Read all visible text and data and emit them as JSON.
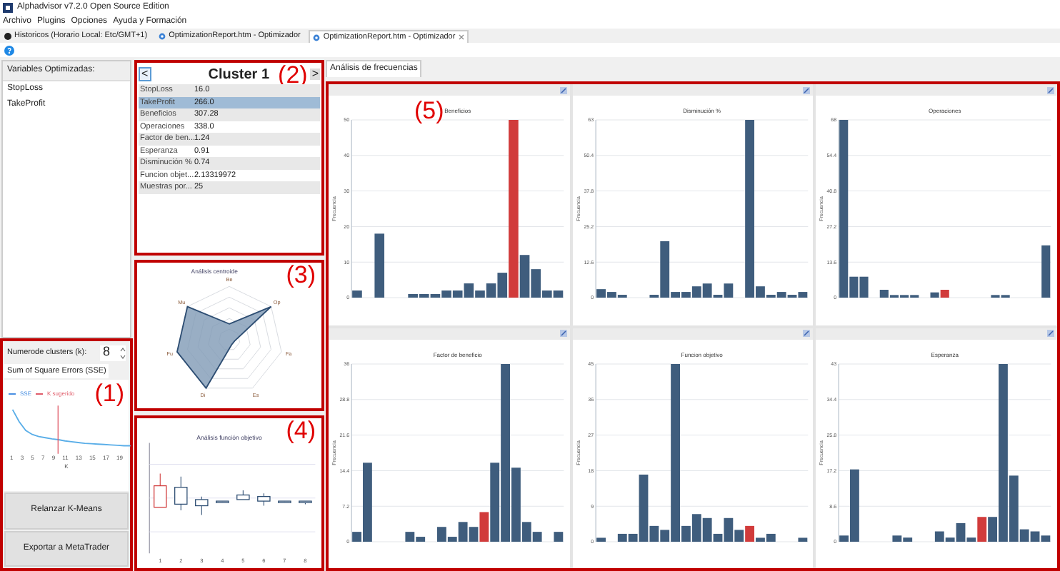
{
  "window": {
    "title": "Alphadvisor v7.2.0 Open Source Edition"
  },
  "menu": [
    "Archivo",
    "Plugins",
    "Opciones",
    "Ayuda y Formación"
  ],
  "tabs": [
    {
      "label": "Historicos (Horario Local: Etc/GMT+1)",
      "kind": "history",
      "selected": false
    },
    {
      "label": "OptimizationReport.htm - Optimizador",
      "kind": "report",
      "selected": false
    },
    {
      "label": "OptimizationReport.htm - Optimizador",
      "kind": "report",
      "selected": true
    }
  ],
  "variables": {
    "header": "Variables Optimizadas:",
    "items": [
      {
        "label": "StopLoss",
        "selected": false
      },
      {
        "label": "TakeProfit",
        "selected": false
      }
    ]
  },
  "kmeans_panel": {
    "annotation": "(1)",
    "spinner": {
      "label": "Numerode clusters (k):",
      "value": "8"
    },
    "tab": "Sum of Square Errors (SSE)",
    "legend": [
      "SSE",
      "K sugerido"
    ],
    "xticks": [
      "1",
      "3",
      "5",
      "7",
      "9",
      "11",
      "13",
      "15",
      "17",
      "19"
    ],
    "xlabel": "K",
    "buttons": [
      "Relanzar K-Means",
      "Exportar a MetaTrader"
    ]
  },
  "cluster_panel": {
    "annotation": "(2)",
    "prev": "<",
    "next": ">",
    "title": "Cluster 1",
    "rows": [
      {
        "name": "StopLoss",
        "value": "16.0",
        "selected": false
      },
      {
        "name": "TakeProfit",
        "value": "266.0",
        "selected": true
      },
      {
        "name": "Beneficios",
        "value": "307.28",
        "selected": false
      },
      {
        "name": "Operaciones",
        "value": "338.0",
        "selected": false
      },
      {
        "name": "Factor de ben...",
        "value": "1.24",
        "selected": false
      },
      {
        "name": "Esperanza",
        "value": "0.91",
        "selected": false
      },
      {
        "name": "Disminución %",
        "value": "0.74",
        "selected": false
      },
      {
        "name": "Funcion objet...",
        "value": "2.13319972",
        "selected": false
      },
      {
        "name": "Muestras por...",
        "value": "25",
        "selected": false
      }
    ]
  },
  "radar_panel": {
    "annotation": "(3)",
    "title": "Análisis centroide",
    "axes": [
      "Be",
      "Op",
      "Fa",
      "Es",
      "Di",
      "Fu",
      "Mu"
    ]
  },
  "boxplot_panel": {
    "annotation": "(4)",
    "title": "Análisis función objetivo",
    "xticks": [
      "1",
      "2",
      "3",
      "4",
      "5",
      "6",
      "7",
      "8"
    ]
  },
  "frequency_panel": {
    "annotation": "(5)",
    "tab": "Análisis de frecuencias",
    "charts": [
      {
        "chart_data": {
          "type": "bar",
          "title": "Beneficios",
          "ylabel": "Frecuencia",
          "ylim": [
            0,
            50
          ],
          "yticks": [
            0,
            10,
            20,
            30,
            40,
            50
          ],
          "grid": true,
          "series": [
            {
              "color": "#3f5d7d",
              "values": [
                2,
                0,
                18,
                0,
                0,
                1,
                1,
                1,
                2,
                2,
                4,
                2,
                4,
                7,
                null,
                12,
                8,
                2,
                2
              ]
            },
            {
              "color": "#d13b3b",
              "values": [
                null,
                null,
                null,
                null,
                null,
                null,
                null,
                null,
                null,
                null,
                null,
                null,
                null,
                null,
                50,
                null,
                null,
                null,
                null
              ]
            }
          ]
        }
      },
      {
        "chart_data": {
          "type": "bar",
          "title": "Disminución %",
          "ylabel": "Frecuencia",
          "ylim": [
            0,
            63
          ],
          "yticks": [
            0,
            12.6,
            25.2,
            37.8,
            50.4,
            63
          ],
          "grid": true,
          "series": [
            {
              "color": "#3f5d7d",
              "values": [
                3,
                2,
                1,
                0,
                0,
                1,
                20,
                2,
                2,
                4,
                5,
                1,
                5,
                0,
                63,
                4,
                1,
                2,
                1,
                2
              ]
            }
          ]
        }
      },
      {
        "chart_data": {
          "type": "bar",
          "title": "Operaciones",
          "ylabel": "Frecuencia",
          "ylim": [
            0,
            68
          ],
          "yticks": [
            0,
            13.6,
            27.2,
            40.8,
            54.4,
            68
          ],
          "grid": true,
          "series": [
            {
              "color": "#3f5d7d",
              "values": [
                68,
                8,
                8,
                0,
                3,
                1,
                1,
                1,
                0,
                2,
                null,
                0,
                0,
                0,
                0,
                1,
                1,
                0,
                0,
                0,
                20
              ]
            },
            {
              "color": "#d13b3b",
              "values": [
                null,
                null,
                null,
                null,
                null,
                null,
                null,
                null,
                null,
                null,
                3,
                null,
                null,
                null,
                null,
                null,
                null,
                null,
                null,
                null,
                null
              ]
            }
          ]
        }
      },
      {
        "chart_data": {
          "type": "bar",
          "title": "Factor de beneficio",
          "ylabel": "Frecuencia",
          "ylim": [
            0,
            36
          ],
          "yticks": [
            0,
            7.2,
            14.4,
            21.6,
            28.8,
            36
          ],
          "grid": true,
          "series": [
            {
              "color": "#3f5d7d",
              "values": [
                2,
                16,
                0,
                0,
                0,
                2,
                1,
                0,
                3,
                1,
                4,
                3,
                null,
                16,
                36,
                15,
                4,
                2,
                0,
                2
              ]
            },
            {
              "color": "#d13b3b",
              "values": [
                null,
                null,
                null,
                null,
                null,
                null,
                null,
                null,
                null,
                null,
                null,
                null,
                6,
                null,
                null,
                null,
                null,
                null,
                null,
                null
              ]
            }
          ]
        }
      },
      {
        "chart_data": {
          "type": "bar",
          "title": "Funcion objetivo",
          "ylabel": "Frecuencia",
          "ylim": [
            0,
            45
          ],
          "yticks": [
            0,
            9,
            18,
            27,
            36,
            45
          ],
          "grid": true,
          "series": [
            {
              "color": "#3f5d7d",
              "values": [
                1,
                0,
                2,
                2,
                17,
                4,
                3,
                45,
                4,
                7,
                6,
                2,
                6,
                3,
                null,
                1,
                2,
                0,
                0,
                1
              ]
            },
            {
              "color": "#d13b3b",
              "values": [
                null,
                null,
                null,
                null,
                null,
                null,
                null,
                null,
                null,
                null,
                null,
                null,
                null,
                null,
                4,
                null,
                null,
                null,
                null,
                null
              ]
            }
          ]
        }
      },
      {
        "chart_data": {
          "type": "bar",
          "title": "Esperanza",
          "ylabel": "Frecuencia",
          "ylim": [
            0,
            43
          ],
          "yticks": [
            0,
            8.6,
            17.2,
            25.8,
            34.4,
            43
          ],
          "grid": true,
          "series": [
            {
              "color": "#3f5d7d",
              "values": [
                1.5,
                17.5,
                0,
                0,
                0,
                1.5,
                1,
                0,
                0,
                2.5,
                1,
                4.5,
                1,
                null,
                6,
                43,
                16,
                3,
                2.5,
                1.5
              ]
            },
            {
              "color": "#d13b3b",
              "values": [
                null,
                null,
                null,
                null,
                null,
                null,
                null,
                null,
                null,
                null,
                null,
                null,
                null,
                6,
                null,
                null,
                null,
                null,
                null,
                null
              ]
            }
          ]
        }
      }
    ]
  }
}
